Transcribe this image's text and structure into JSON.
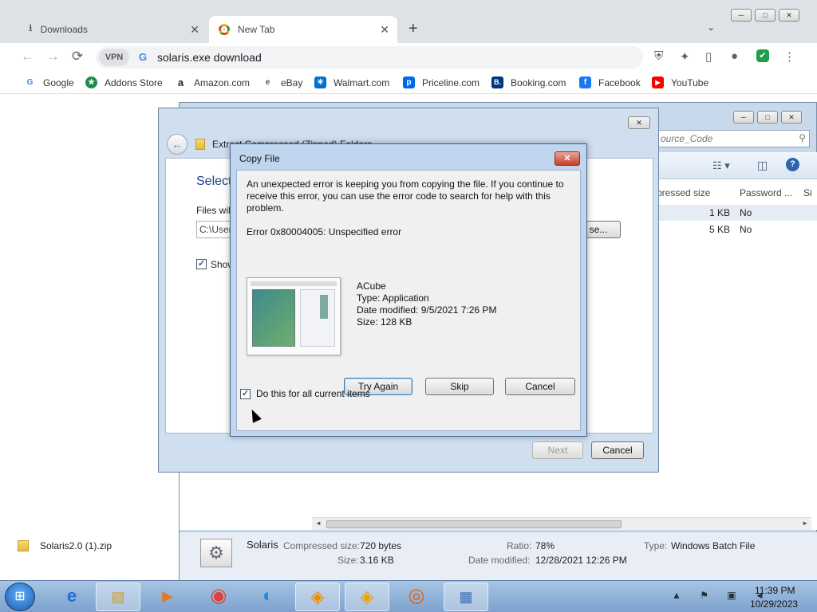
{
  "browser": {
    "tabs": [
      {
        "label": "Downloads",
        "close": "✕"
      },
      {
        "label": "New Tab",
        "close": "✕"
      }
    ],
    "new_tab": "+",
    "tab_menu": "⌄",
    "window_buttons": {
      "minimize": "─",
      "maximize": "□",
      "close": "✕"
    },
    "nav": {
      "back": "←",
      "forward": "→",
      "reload": "⟳"
    },
    "omnibox": {
      "vpn": "VPN",
      "engine": "G",
      "text": "solaris.exe download"
    },
    "toolbar_icons": {
      "shield": "⛨",
      "extensions": "✦",
      "sidebar": "▯",
      "profile": "●",
      "security": "✔",
      "menu": "⋮"
    },
    "bookmarks": [
      {
        "label": "Google",
        "icon": "G",
        "color": "#4285f4"
      },
      {
        "label": "Addons Store",
        "icon": "★",
        "color": "#1a8c4a"
      },
      {
        "label": "Amazon.com",
        "icon": "a",
        "color": "#222222"
      },
      {
        "label": "eBay",
        "icon": "e",
        "color": "#555555"
      },
      {
        "label": "Walmart.com",
        "icon": "✳",
        "color": "#0071ce"
      },
      {
        "label": "Priceline.com",
        "icon": "p",
        "color": "#0068ef"
      },
      {
        "label": "Booking.com",
        "icon": "B.",
        "color": "#003580"
      },
      {
        "label": "Facebook",
        "icon": "f",
        "color": "#1877f2"
      },
      {
        "label": "YouTube",
        "icon": "▶",
        "color": "#ff0000"
      }
    ]
  },
  "sidebar": {
    "zip_file": "Solaris2.0 (1).zip",
    "zip_arrow": "^"
  },
  "explorer": {
    "search_placeholder": "ource_Code",
    "columns": [
      "pressed size",
      "Password ...",
      "Si"
    ],
    "rows": [
      {
        "size": "1 KB",
        "password": "No"
      },
      {
        "size": "5 KB",
        "password": "No"
      }
    ],
    "details": {
      "name": "Solaris",
      "compressed_label": "Compressed size:",
      "compressed_value": "720 bytes",
      "size_label": "Size:",
      "size_value": "3.16 KB",
      "ratio_label": "Ratio:",
      "ratio_value": "78%",
      "date_label": "Date modified:",
      "date_value": "12/28/2021 12:26 PM",
      "type_label": "Type:",
      "type_value": "Windows Batch File"
    }
  },
  "extract": {
    "title": "Extract Compressed (Zipped) Folders",
    "heading": "Select",
    "files_label": "Files will",
    "path_value": "C:\\User",
    "browse": "se...",
    "show_label": "Show",
    "next": "Next",
    "cancel": "Cancel"
  },
  "copy_dialog": {
    "title": "Copy File",
    "message": "An unexpected error is keeping you from copying the file. If you continue to receive this error, you can use the error code to search for help with this problem.",
    "error": "Error 0x80004005: Unspecified error",
    "file_name": "ACube",
    "file_type": "Type: Application",
    "file_date": "Date modified: 9/5/2021 7:26 PM",
    "file_size": "Size: 128 KB",
    "try_again": "Try Again",
    "skip": "Skip",
    "cancel": "Cancel",
    "checkbox_label": "Do this for all current items",
    "checkbox_checked": true
  },
  "taskbar": {
    "start": "⊞",
    "apps": [
      {
        "name": "Internet Explorer",
        "icon": "e",
        "color": "#1f6fd6"
      },
      {
        "name": "File Explorer",
        "icon": "▤",
        "color": "#c89a30"
      },
      {
        "name": "Media Player",
        "icon": "▶",
        "color": "#e07a2a"
      },
      {
        "name": "Chrome",
        "icon": "◉",
        "color": "#db4437"
      },
      {
        "name": "Edge",
        "icon": "◐",
        "color": "#1c8fd6"
      },
      {
        "name": "Avast",
        "icon": "◈",
        "color": "#f08a00"
      },
      {
        "name": "Avast Secure Browser",
        "icon": "◈",
        "color": "#f0a000"
      },
      {
        "name": "Firefox",
        "icon": "◎",
        "color": "#e66000"
      },
      {
        "name": "Network",
        "icon": "▦",
        "color": "#3a6fb0"
      }
    ],
    "tray_icons": "▲ ⚑ ▣ ◄",
    "time": "11:39 PM",
    "date": "10/29/2023"
  }
}
